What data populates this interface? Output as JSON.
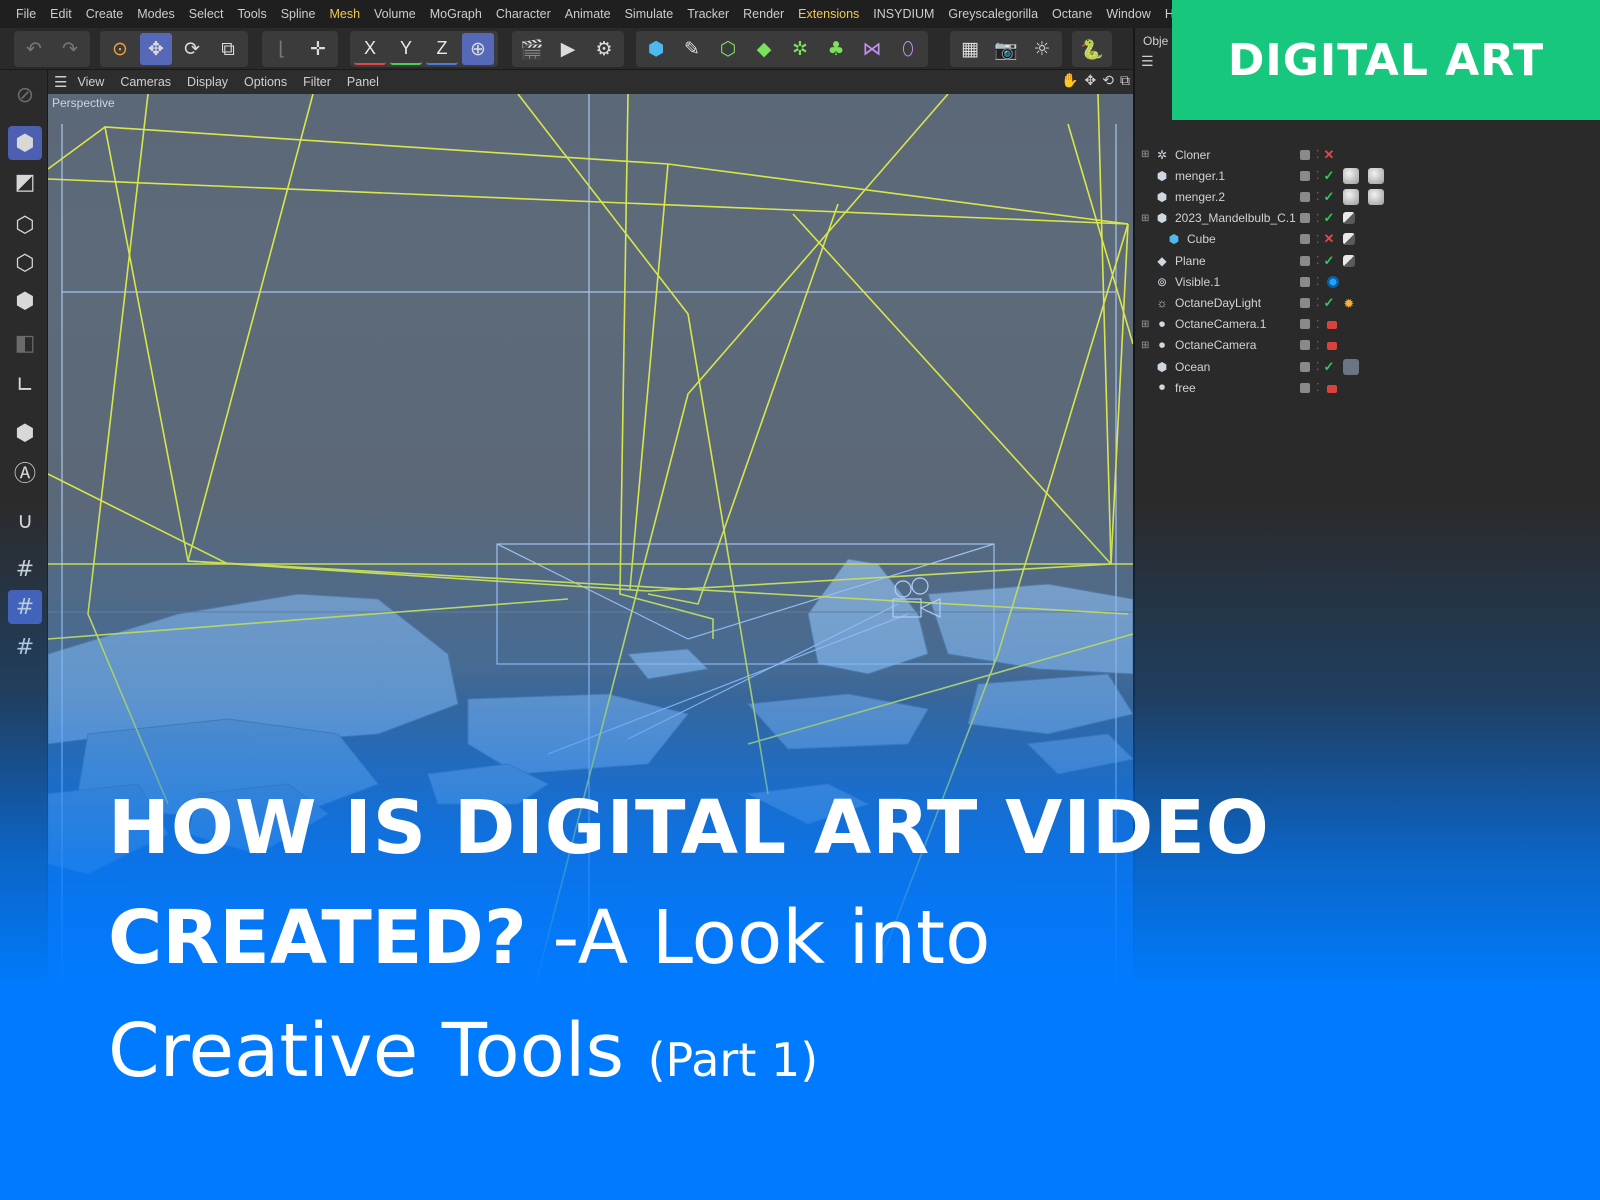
{
  "menu": [
    "File",
    "Edit",
    "Create",
    "Modes",
    "Select",
    "Tools",
    "Spline",
    "Mesh",
    "Volume",
    "MoGraph",
    "Character",
    "Animate",
    "Simulate",
    "Tracker",
    "Render",
    "Extensions",
    "INSYDIUM",
    "Greyscalegorilla",
    "Octane",
    "Window",
    "Help"
  ],
  "toolbar": {
    "axis_x": "X",
    "axis_y": "Y",
    "axis_z": "Z"
  },
  "viewport": {
    "menu": [
      "View",
      "Cameras",
      "Display",
      "Options",
      "Filter",
      "Panel"
    ],
    "camera_label": "Perspective"
  },
  "object_manager": {
    "tab_label": "Obje",
    "objects": [
      {
        "name": "Cloner",
        "icon": "cloner-icon",
        "state": "off"
      },
      {
        "name": "menger.1",
        "icon": "object-icon",
        "state": "on"
      },
      {
        "name": "menger.2",
        "icon": "object-icon",
        "state": "on"
      },
      {
        "name": "2023_Mandelbulb_C.1",
        "icon": "object-icon",
        "state": "on"
      },
      {
        "name": "Cube",
        "icon": "cube-icon",
        "state": "off"
      },
      {
        "name": "Plane",
        "icon": "plane-icon",
        "state": "on"
      },
      {
        "name": "Visible.1",
        "icon": "visible-icon",
        "state": "none"
      },
      {
        "name": "OctaneDayLight",
        "icon": "daylight-icon",
        "state": "on"
      },
      {
        "name": "OctaneCamera.1",
        "icon": "camera-icon",
        "state": "none"
      },
      {
        "name": "OctaneCamera",
        "icon": "camera-icon",
        "state": "none"
      },
      {
        "name": "Ocean",
        "icon": "object-icon",
        "state": "on"
      },
      {
        "name": "free",
        "icon": "camera-icon",
        "state": "none"
      }
    ]
  },
  "badge": "DIGITAL ART",
  "headline": {
    "line1": "HOW IS DIGITAL ART VIDEO",
    "line2_bold": "CREATED? ",
    "line2_rest": "-A Look into",
    "line3": "Creative Tools",
    "part": "(Part 1)"
  },
  "colors": {
    "badge_green": "#17c77e",
    "overlay_blue": "#007bff",
    "wire_yellow": "#d9e64a",
    "wire_blue": "#a9c6ef"
  }
}
